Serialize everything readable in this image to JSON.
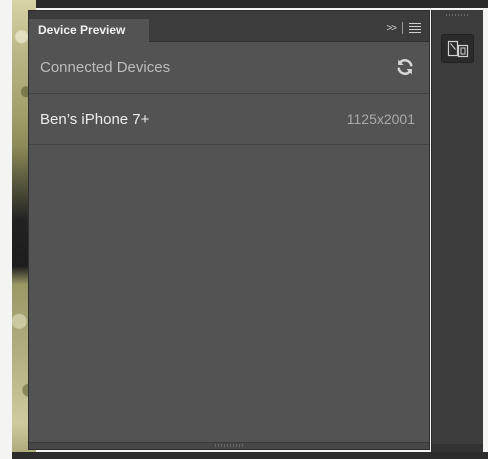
{
  "panel": {
    "tab_label": "Device Preview",
    "section_title": "Connected Devices",
    "header_icons": {
      "expand": "double-chevron-right-icon",
      "menu": "hamburger-menu-icon"
    },
    "refresh_icon": "refresh-icon",
    "devices": [
      {
        "name": "Ben’s iPhone 7+",
        "resolution": "1125x2001"
      }
    ]
  },
  "dock": {
    "button_icon": "device-preview-icon"
  },
  "colors": {
    "panel_bg": "#535353",
    "header_bg": "#3c3c3c",
    "text_primary": "#ececec",
    "text_secondary": "#bdbdbd"
  }
}
